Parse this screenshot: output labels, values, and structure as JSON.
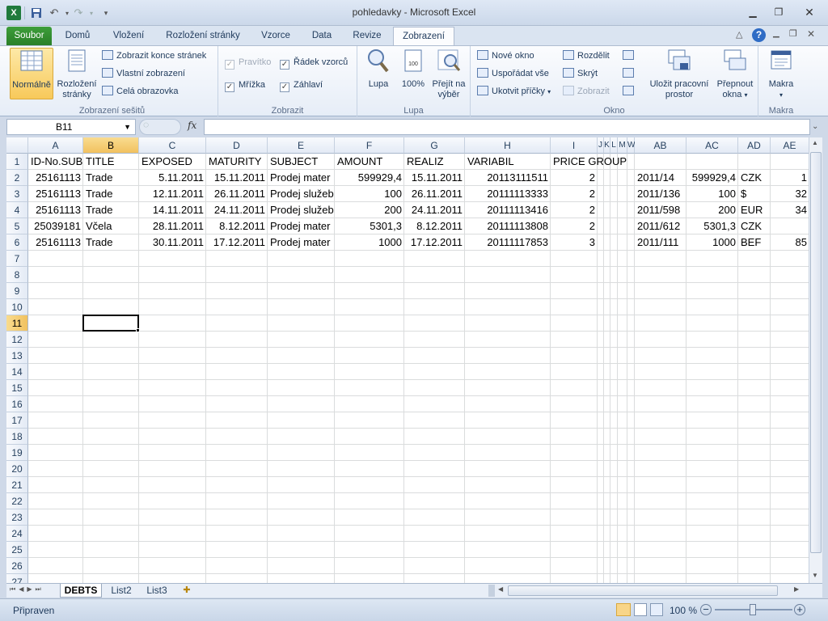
{
  "window": {
    "title": "pohledavky - Microsoft Excel"
  },
  "tabs": [
    "Soubor",
    "Domů",
    "Vložení",
    "Rozložení stránky",
    "Vzorce",
    "Data",
    "Revize",
    "Zobrazení"
  ],
  "ribbon": {
    "workbook_views": {
      "label": "Zobrazení sešitů",
      "normal": "Normálně",
      "page_layout_1": "Rozložení",
      "page_layout_2": "stránky",
      "page_break": "Zobrazit konce stránek",
      "custom": "Vlastní zobrazení",
      "fullscreen": "Celá obrazovka"
    },
    "show": {
      "label": "Zobrazit",
      "ruler": "Pravítko",
      "formula_bar": "Řádek vzorců",
      "gridlines": "Mřížka",
      "headings": "Záhlaví"
    },
    "zoom": {
      "label": "Lupa",
      "zoom": "Lupa",
      "hundred": "100%",
      "sel_1": "Přejít na",
      "sel_2": "výběr"
    },
    "window": {
      "label": "Okno",
      "new": "Nové okno",
      "arrange": "Uspořádat vše",
      "freeze": "Ukotvit příčky",
      "split": "Rozdělit",
      "hide": "Skrýt",
      "unhide": "Zobrazit",
      "save_ws_1": "Uložit pracovní",
      "save_ws_2": "prostor",
      "switch_1": "Přepnout",
      "switch_2": "okna"
    },
    "macros": {
      "label": "Makra",
      "macros": "Makra"
    }
  },
  "formula_bar": {
    "name_box": "B11",
    "fx": "fx",
    "value": ""
  },
  "grid": {
    "columns": [
      "A",
      "B",
      "C",
      "D",
      "E",
      "F",
      "G",
      "H",
      "I",
      "J",
      "K",
      "L",
      "M",
      "W",
      "AB",
      "AC",
      "AD",
      "AE"
    ],
    "rows": [
      "1",
      "2",
      "3",
      "4",
      "5",
      "6",
      "7",
      "8",
      "9",
      "10",
      "11",
      "12",
      "13",
      "14",
      "15",
      "16",
      "17",
      "18",
      "19",
      "20",
      "21",
      "22",
      "23",
      "24",
      "25",
      "26",
      "27"
    ],
    "selected_cell": "B11",
    "header_row": [
      "ID-No.SUB",
      "TITLE",
      "EXPOSED",
      "MATURITY",
      "SUBJECT",
      "AMOUNT",
      "REALIZ",
      "VARIABIL",
      "PRICE GROUP"
    ],
    "data_rows": [
      {
        "id": "25161113",
        "title": "Trade",
        "exposed": "5.11.2011",
        "maturity": "15.11.2011",
        "subject": "Prodej mater",
        "amount": "599929,4",
        "realiz": "15.11.2011",
        "variabil": "20113111511",
        "price": "2",
        "ab": "2011/14",
        "ac": "599929,4",
        "ad": "CZK",
        "ae": "1"
      },
      {
        "id": "25161113",
        "title": "Trade",
        "exposed": "12.11.2011",
        "maturity": "26.11.2011",
        "subject": "Prodej služeb",
        "amount": "100",
        "realiz": "26.11.2011",
        "variabil": "20111113333",
        "price": "2",
        "ab": "2011/136",
        "ac": "100",
        "ad": "$",
        "ae": "32"
      },
      {
        "id": "25161113",
        "title": "Trade",
        "exposed": "14.11.2011",
        "maturity": "24.11.2011",
        "subject": "Prodej služeb",
        "amount": "200",
        "realiz": "24.11.2011",
        "variabil": "20111113416",
        "price": "2",
        "ab": "2011/598",
        "ac": "200",
        "ad": "EUR",
        "ae": "34"
      },
      {
        "id": "25039181",
        "title": "Včela",
        "exposed": "28.11.2011",
        "maturity": "8.12.2011",
        "subject": "Prodej mater",
        "amount": "5301,3",
        "realiz": "8.12.2011",
        "variabil": "20111113808",
        "price": "2",
        "ab": "2011/612",
        "ac": "5301,3",
        "ad": "CZK",
        "ae": ""
      },
      {
        "id": "25161113",
        "title": "Trade",
        "exposed": "30.11.2011",
        "maturity": "17.12.2011",
        "subject": "Prodej mater",
        "amount": "1000",
        "realiz": "17.12.2011",
        "variabil": "20111117853",
        "price": "3",
        "ab": "2011/111",
        "ac": "1000",
        "ad": "BEF",
        "ae": "85"
      }
    ]
  },
  "sheets": [
    "DEBTS",
    "List2",
    "List3"
  ],
  "status": {
    "ready": "Připraven",
    "zoom": "100 %"
  }
}
